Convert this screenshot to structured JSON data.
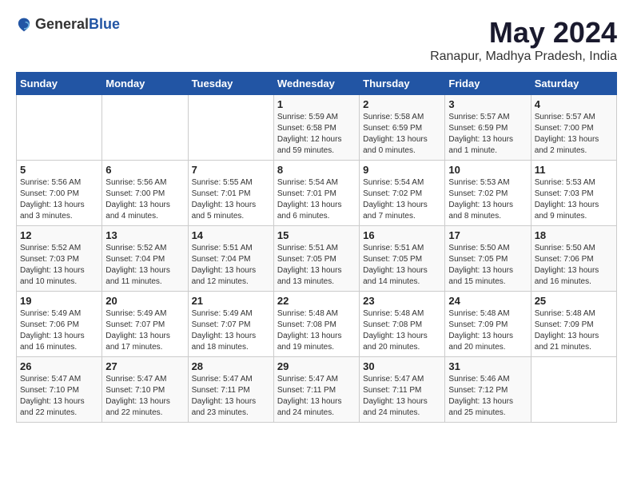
{
  "header": {
    "logo_general": "General",
    "logo_blue": "Blue",
    "month_title": "May 2024",
    "location": "Ranapur, Madhya Pradesh, India"
  },
  "columns": [
    "Sunday",
    "Monday",
    "Tuesday",
    "Wednesday",
    "Thursday",
    "Friday",
    "Saturday"
  ],
  "weeks": [
    [
      {
        "day": "",
        "sunrise": "",
        "sunset": "",
        "daylight": ""
      },
      {
        "day": "",
        "sunrise": "",
        "sunset": "",
        "daylight": ""
      },
      {
        "day": "",
        "sunrise": "",
        "sunset": "",
        "daylight": ""
      },
      {
        "day": "1",
        "sunrise": "Sunrise: 5:59 AM",
        "sunset": "Sunset: 6:58 PM",
        "daylight": "Daylight: 12 hours and 59 minutes."
      },
      {
        "day": "2",
        "sunrise": "Sunrise: 5:58 AM",
        "sunset": "Sunset: 6:59 PM",
        "daylight": "Daylight: 13 hours and 0 minutes."
      },
      {
        "day": "3",
        "sunrise": "Sunrise: 5:57 AM",
        "sunset": "Sunset: 6:59 PM",
        "daylight": "Daylight: 13 hours and 1 minute."
      },
      {
        "day": "4",
        "sunrise": "Sunrise: 5:57 AM",
        "sunset": "Sunset: 7:00 PM",
        "daylight": "Daylight: 13 hours and 2 minutes."
      }
    ],
    [
      {
        "day": "5",
        "sunrise": "Sunrise: 5:56 AM",
        "sunset": "Sunset: 7:00 PM",
        "daylight": "Daylight: 13 hours and 3 minutes."
      },
      {
        "day": "6",
        "sunrise": "Sunrise: 5:56 AM",
        "sunset": "Sunset: 7:00 PM",
        "daylight": "Daylight: 13 hours and 4 minutes."
      },
      {
        "day": "7",
        "sunrise": "Sunrise: 5:55 AM",
        "sunset": "Sunset: 7:01 PM",
        "daylight": "Daylight: 13 hours and 5 minutes."
      },
      {
        "day": "8",
        "sunrise": "Sunrise: 5:54 AM",
        "sunset": "Sunset: 7:01 PM",
        "daylight": "Daylight: 13 hours and 6 minutes."
      },
      {
        "day": "9",
        "sunrise": "Sunrise: 5:54 AM",
        "sunset": "Sunset: 7:02 PM",
        "daylight": "Daylight: 13 hours and 7 minutes."
      },
      {
        "day": "10",
        "sunrise": "Sunrise: 5:53 AM",
        "sunset": "Sunset: 7:02 PM",
        "daylight": "Daylight: 13 hours and 8 minutes."
      },
      {
        "day": "11",
        "sunrise": "Sunrise: 5:53 AM",
        "sunset": "Sunset: 7:03 PM",
        "daylight": "Daylight: 13 hours and 9 minutes."
      }
    ],
    [
      {
        "day": "12",
        "sunrise": "Sunrise: 5:52 AM",
        "sunset": "Sunset: 7:03 PM",
        "daylight": "Daylight: 13 hours and 10 minutes."
      },
      {
        "day": "13",
        "sunrise": "Sunrise: 5:52 AM",
        "sunset": "Sunset: 7:04 PM",
        "daylight": "Daylight: 13 hours and 11 minutes."
      },
      {
        "day": "14",
        "sunrise": "Sunrise: 5:51 AM",
        "sunset": "Sunset: 7:04 PM",
        "daylight": "Daylight: 13 hours and 12 minutes."
      },
      {
        "day": "15",
        "sunrise": "Sunrise: 5:51 AM",
        "sunset": "Sunset: 7:05 PM",
        "daylight": "Daylight: 13 hours and 13 minutes."
      },
      {
        "day": "16",
        "sunrise": "Sunrise: 5:51 AM",
        "sunset": "Sunset: 7:05 PM",
        "daylight": "Daylight: 13 hours and 14 minutes."
      },
      {
        "day": "17",
        "sunrise": "Sunrise: 5:50 AM",
        "sunset": "Sunset: 7:05 PM",
        "daylight": "Daylight: 13 hours and 15 minutes."
      },
      {
        "day": "18",
        "sunrise": "Sunrise: 5:50 AM",
        "sunset": "Sunset: 7:06 PM",
        "daylight": "Daylight: 13 hours and 16 minutes."
      }
    ],
    [
      {
        "day": "19",
        "sunrise": "Sunrise: 5:49 AM",
        "sunset": "Sunset: 7:06 PM",
        "daylight": "Daylight: 13 hours and 16 minutes."
      },
      {
        "day": "20",
        "sunrise": "Sunrise: 5:49 AM",
        "sunset": "Sunset: 7:07 PM",
        "daylight": "Daylight: 13 hours and 17 minutes."
      },
      {
        "day": "21",
        "sunrise": "Sunrise: 5:49 AM",
        "sunset": "Sunset: 7:07 PM",
        "daylight": "Daylight: 13 hours and 18 minutes."
      },
      {
        "day": "22",
        "sunrise": "Sunrise: 5:48 AM",
        "sunset": "Sunset: 7:08 PM",
        "daylight": "Daylight: 13 hours and 19 minutes."
      },
      {
        "day": "23",
        "sunrise": "Sunrise: 5:48 AM",
        "sunset": "Sunset: 7:08 PM",
        "daylight": "Daylight: 13 hours and 20 minutes."
      },
      {
        "day": "24",
        "sunrise": "Sunrise: 5:48 AM",
        "sunset": "Sunset: 7:09 PM",
        "daylight": "Daylight: 13 hours and 20 minutes."
      },
      {
        "day": "25",
        "sunrise": "Sunrise: 5:48 AM",
        "sunset": "Sunset: 7:09 PM",
        "daylight": "Daylight: 13 hours and 21 minutes."
      }
    ],
    [
      {
        "day": "26",
        "sunrise": "Sunrise: 5:47 AM",
        "sunset": "Sunset: 7:10 PM",
        "daylight": "Daylight: 13 hours and 22 minutes."
      },
      {
        "day": "27",
        "sunrise": "Sunrise: 5:47 AM",
        "sunset": "Sunset: 7:10 PM",
        "daylight": "Daylight: 13 hours and 22 minutes."
      },
      {
        "day": "28",
        "sunrise": "Sunrise: 5:47 AM",
        "sunset": "Sunset: 7:11 PM",
        "daylight": "Daylight: 13 hours and 23 minutes."
      },
      {
        "day": "29",
        "sunrise": "Sunrise: 5:47 AM",
        "sunset": "Sunset: 7:11 PM",
        "daylight": "Daylight: 13 hours and 24 minutes."
      },
      {
        "day": "30",
        "sunrise": "Sunrise: 5:47 AM",
        "sunset": "Sunset: 7:11 PM",
        "daylight": "Daylight: 13 hours and 24 minutes."
      },
      {
        "day": "31",
        "sunrise": "Sunrise: 5:46 AM",
        "sunset": "Sunset: 7:12 PM",
        "daylight": "Daylight: 13 hours and 25 minutes."
      },
      {
        "day": "",
        "sunrise": "",
        "sunset": "",
        "daylight": ""
      }
    ]
  ]
}
